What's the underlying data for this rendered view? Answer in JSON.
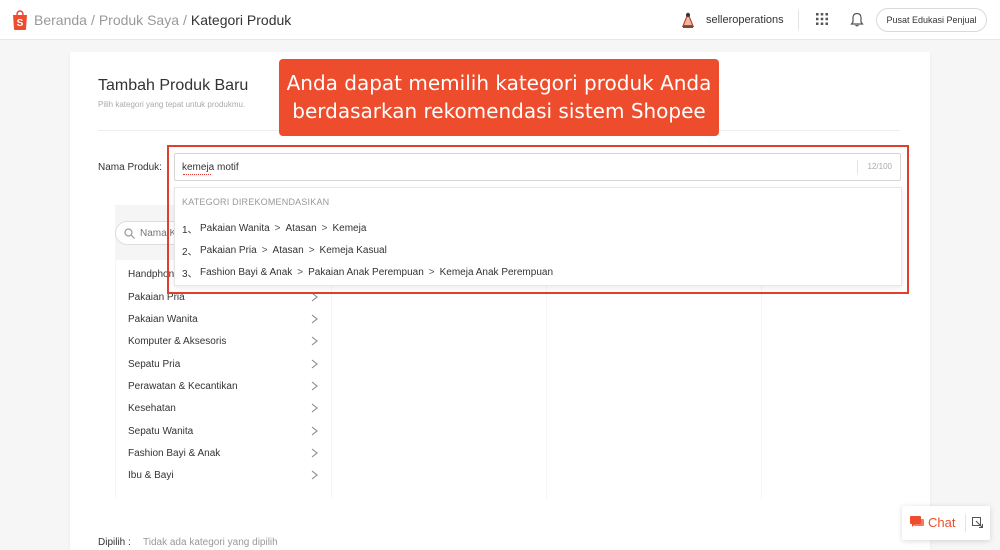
{
  "header": {
    "breadcrumb": [
      "Beranda",
      "Produk Saya"
    ],
    "breadcrumb_current": "Kategori Produk",
    "username": "selleroperations",
    "edu_button": "Pusat Edukasi Penjual"
  },
  "form": {
    "title": "Tambah Produk Baru",
    "subtitle": "Pilih kategori yang tepat untuk produkmu.",
    "name_label": "Nama Produk:",
    "name_value": "kemeja motif",
    "char_count": "12/100"
  },
  "browser": {
    "search_placeholder": "Nama Kategori",
    "categories": [
      "Handphone & Aksesoris",
      "Pakaian Pria",
      "Pakaian Wanita",
      "Komputer & Aksesoris",
      "Sepatu Pria",
      "Perawatan & Kecantikan",
      "Kesehatan",
      "Sepatu Wanita",
      "Fashion Bayi & Anak",
      "Ibu & Bayi"
    ]
  },
  "suggestions": {
    "heading": "KATEGORI DIREKOMENDASIKAN",
    "items": [
      {
        "num": "1、",
        "path": [
          "Pakaian Wanita",
          "Atasan",
          "Kemeja"
        ]
      },
      {
        "num": "2、",
        "path": [
          "Pakaian Pria",
          "Atasan",
          "Kemeja Kasual"
        ]
      },
      {
        "num": "3、",
        "path": [
          "Fashion Bayi & Anak",
          "Pakaian Anak Perempuan",
          "Kemeja Anak Perempuan"
        ]
      }
    ]
  },
  "chosen": {
    "label": "Dipilih :",
    "value": "Tidak ada kategori yang dipilih"
  },
  "callout": {
    "line1": "Anda dapat memilih kategori produk Anda",
    "line2": "berdasarkan rekomendasi sistem Shopee"
  },
  "chat": {
    "label": "Chat"
  },
  "colors": {
    "brand": "#ee4d2d",
    "highlight": "#e0402b"
  }
}
